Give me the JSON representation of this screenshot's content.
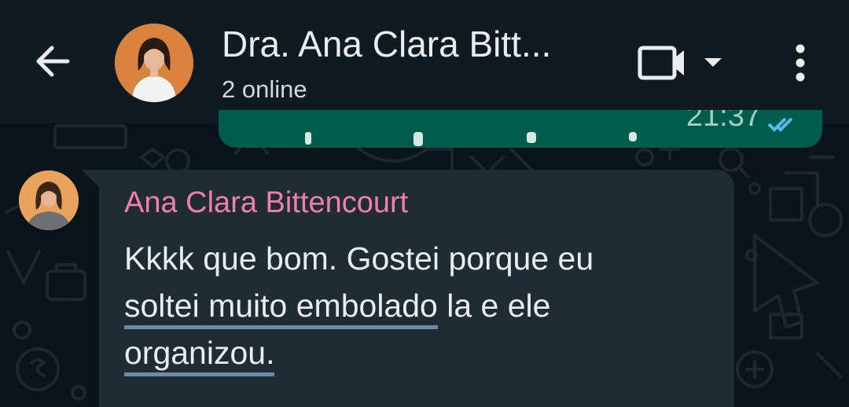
{
  "header": {
    "back_icon": "arrow-left-icon",
    "title": "Dra. Ana Clara Bitt...",
    "subtitle": "2 online",
    "video_icon": "video-call-icon",
    "dropdown_icon": "caret-down-icon",
    "menu_icon": "more-vertical-icon"
  },
  "previous_message": {
    "time": "21:37",
    "status_icon": "double-check-icon"
  },
  "message": {
    "sender": "Ana Clara Bittencourt",
    "line1": "Kkkk que bom. Gostei porque eu",
    "line2_underlined": "soltei muito embolado",
    "line2_rest": " la e ele",
    "line3_underlined": "organizou."
  },
  "colors": {
    "header_bg": "#101a20",
    "chat_bg": "#0b141a",
    "incoming_bubble": "#202c33",
    "outgoing_bubble": "#005c4b",
    "sender_name": "#f27fa8",
    "spellcheck_underline": "#6a8aa8"
  }
}
